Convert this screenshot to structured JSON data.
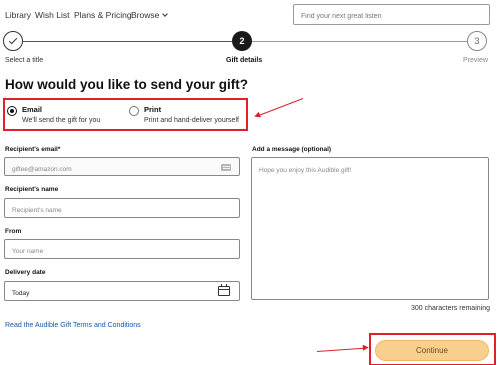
{
  "nav": {
    "items": [
      {
        "label": "Library"
      },
      {
        "label": "Wish List"
      },
      {
        "label": "Plans & Pricing"
      },
      {
        "label": "Browse"
      }
    ],
    "search_placeholder": "Find your next great listen"
  },
  "stepper": {
    "steps": [
      {
        "number": "1",
        "label": "Select a title",
        "state": "complete"
      },
      {
        "number": "2",
        "label": "Gift details",
        "state": "current"
      },
      {
        "number": "3",
        "label": "Preview",
        "state": "upcoming"
      }
    ]
  },
  "heading": "How would you like to send your gift?",
  "send_options": {
    "selected": "email",
    "email": {
      "title": "Email",
      "description": "We'll send the gift for you"
    },
    "print": {
      "title": "Print",
      "description": "Print and hand-deliver yourself"
    }
  },
  "form": {
    "recipient_email": {
      "label": "Recipient's email*",
      "placeholder": "giftee@amazon.com",
      "value": ""
    },
    "recipient_name": {
      "label": "Recipient's name",
      "placeholder": "Recipient's name",
      "value": ""
    },
    "from": {
      "label": "From",
      "placeholder": "Your name",
      "value": ""
    },
    "delivery_date": {
      "label": "Delivery date",
      "value": "Today"
    },
    "message": {
      "label": "Add a message (optional)",
      "placeholder": "Hope you enjoy this Audible gift!",
      "value": ""
    },
    "characters_remaining": "300 characters remaining"
  },
  "terms_link": "Read the Audible Gift Terms and Conditions",
  "continue_label": "Continue",
  "colors": {
    "annotation_red": "#e0202a",
    "continue_bg": "#f9cf8f",
    "link_blue": "#1a56a8"
  }
}
